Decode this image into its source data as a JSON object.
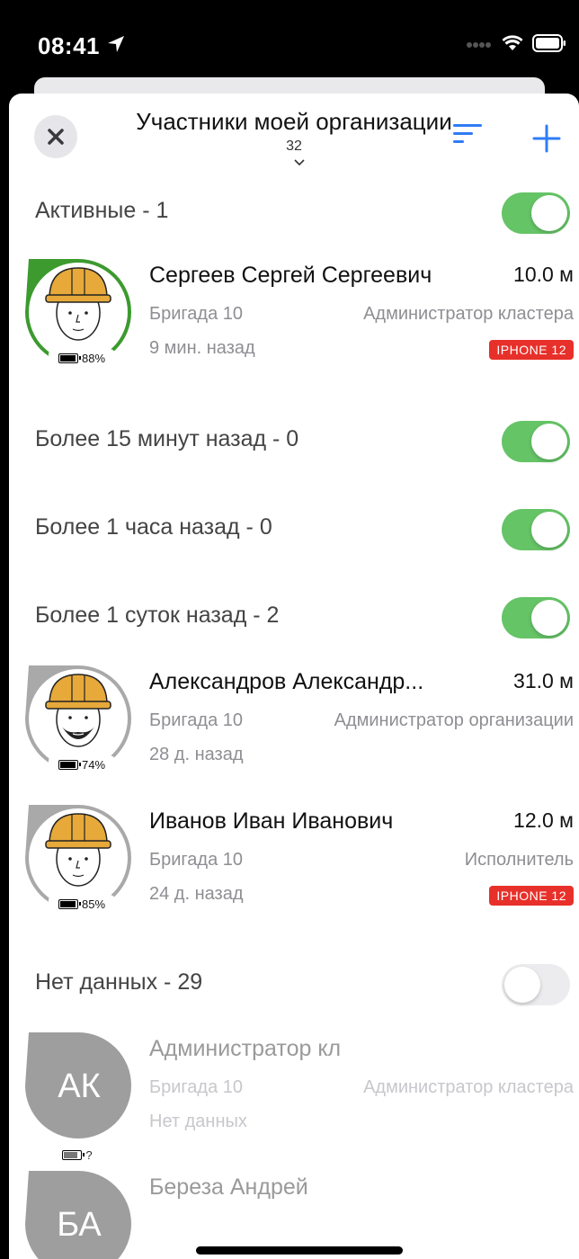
{
  "status_bar": {
    "time": "08:41"
  },
  "header": {
    "title": "Участники моей организации",
    "count": "32",
    "accent_color": "#2f7cf6"
  },
  "groups": [
    {
      "label": "Активные  -  1",
      "enabled": true
    },
    {
      "label": "Более 15 минут назад  -  0",
      "enabled": true
    },
    {
      "label": "Более 1 часа назад  -  0",
      "enabled": true
    },
    {
      "label": "Более 1 суток назад  -  2",
      "enabled": true
    },
    {
      "label": "Нет данных  -  29",
      "enabled": false
    }
  ],
  "members": [
    {
      "name": "Сергеев Сергей Сергеевич",
      "distance": "10.0 м",
      "team": "Бригада 10",
      "role": "Администратор кластера",
      "last_seen": "9 мин. назад",
      "battery": "88%",
      "device": "IPHONE 12",
      "ring_color": "#3c9a2f"
    },
    {
      "name": "Александров Александр...",
      "distance": "31.0 м",
      "team": "Бригада 10",
      "role": "Администратор организации",
      "last_seen": "28 д. назад",
      "battery": "74%",
      "ring_color": "#a9a9a9"
    },
    {
      "name": "Иванов Иван Иванович",
      "distance": "12.0 м",
      "team": "Бригада 10",
      "role": "Исполнитель",
      "last_seen": "24 д. назад",
      "battery": "85%",
      "device": "IPHONE 12",
      "ring_color": "#a9a9a9"
    }
  ],
  "nodata_members": [
    {
      "initials": "АК",
      "name": "Администратор кл",
      "team": "Бригада 10",
      "role": "Администратор кластера",
      "last_seen": "Нет данных",
      "battery": "?"
    },
    {
      "initials": "БА",
      "name": "Береза Андрей"
    }
  ]
}
